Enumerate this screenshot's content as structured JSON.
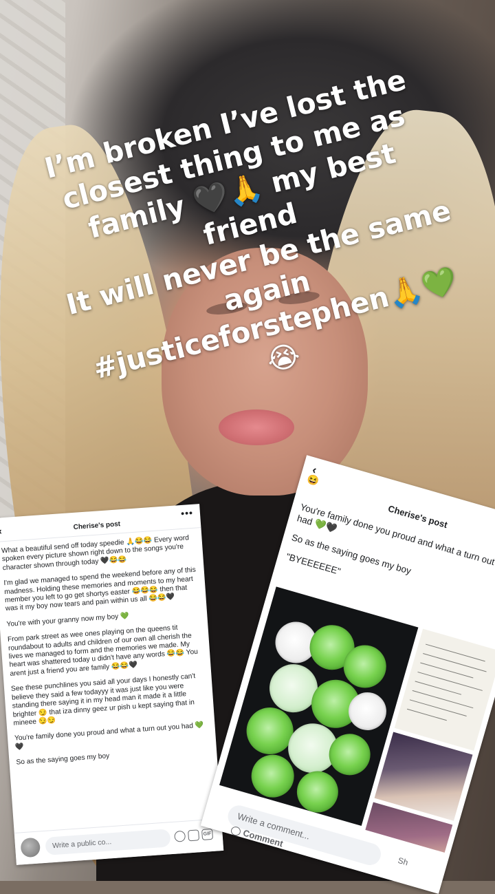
{
  "caption": {
    "lines": [
      "I’m broken I’ve lost the",
      "closest thing to me as",
      "family 🖤🙏 my best",
      "friend",
      "It will never be the same",
      "again",
      "#justiceforstephen🙏💚",
      "😭"
    ]
  },
  "left_post": {
    "title": "Cherise's post",
    "back_icon": "chevron-left-icon",
    "more_icon": "more-dots-icon",
    "paragraphs": [
      "What a beautiful send off today speedie 🙏😂😂 Every word spoken every picture shown right down to the songs you're character shown through today 🖤😂😂",
      "I'm glad we managed to spend the weekend before any of this madness. Holding these memories and moments to my heart member you left to go get shortys easter 😂😂😂 then that was it my boy now tears and pain within us all 😂😂🖤",
      "You're with your granny now my boy 💚",
      "From park street as wee ones playing on the queens tit roundabout to adults and children of our own all cherish the lives we managed to form and the memories we made. My heart was shattered today u didn't have any words 😂😂 You arent just a friend you are family 😂😂🖤",
      "See these punchlines you said all your days I honestly can't believe they said a few todayyy it was just like you were standing there saying it in my head man it made it a little brighter 😏 that iza dinny geez ur pish u kept saying that in mineee 😏😏",
      "You're family done you proud and what a turn out you had 💚🖤",
      "So as the saying goes my boy"
    ],
    "comment_placeholder": "Write a public co...",
    "tools": [
      "sticker-icon",
      "camera-icon",
      "gif-icon",
      "emoji-icon"
    ],
    "gif_label": "GIF"
  },
  "right_post": {
    "title": "Cherise's post",
    "back_icon": "chevron-left-icon",
    "emoji": "😆",
    "paragraphs": [
      "You're family done you proud and what a turn out you had 💚🖤",
      "So as the saying goes my boy",
      "\"BYEEEEEE\""
    ],
    "comment_label": "Comment",
    "comment_placeholder": "Write a comment...",
    "share_label": "Sh"
  }
}
